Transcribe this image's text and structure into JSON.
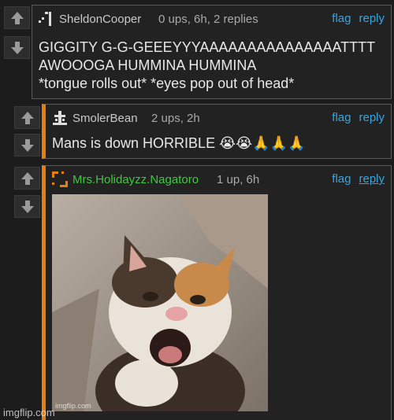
{
  "comments": [
    {
      "username": "SheldonCooper",
      "meta": "0 ups, 6h, 2 replies",
      "flag": "flag",
      "reply": "reply",
      "body_lines": [
        "GIGGITY G-G-GEEEYYYAAAAAAAAAAAAAAATTTT",
        "AWOOOGA HUMMINA HUMMINA",
        "*tongue rolls out* *eyes pop out of head*"
      ]
    },
    {
      "username": "SmolerBean",
      "meta": "2 ups, 2h",
      "flag": "flag",
      "reply": "reply",
      "body": "Mans is down HORRIBLE 😭😭🙏🙏🙏"
    },
    {
      "username": "Mrs.Holidayzz.Nagatoro",
      "meta": "1 up, 6h",
      "flag": "flag",
      "reply": "reply",
      "image_watermark": "imgflip.com"
    }
  ],
  "page_watermark": "imgflip.com",
  "colors": {
    "accent": "#e67e12",
    "link": "#32a8e6",
    "green_user": "#3ec93e"
  }
}
